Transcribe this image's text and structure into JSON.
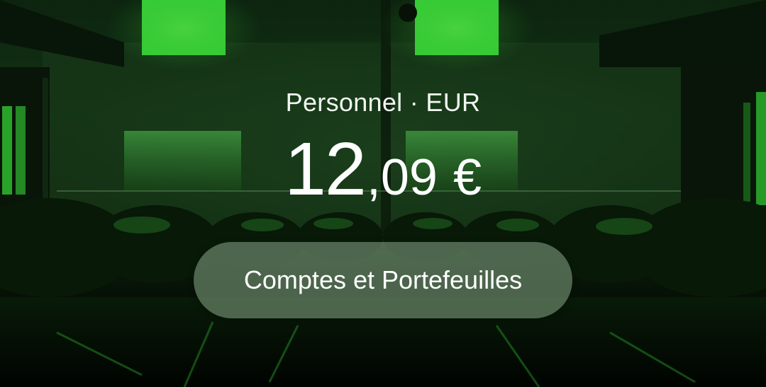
{
  "account": {
    "name": "Personnel",
    "separator": "·",
    "currency": "EUR"
  },
  "balance": {
    "integer_part": "12",
    "decimal_part": ",09",
    "currency_symbol": "€"
  },
  "actions": {
    "accounts_button_label": "Comptes et Portefeuilles"
  },
  "colors": {
    "accent_green": "#39e639",
    "button_background": "#789678"
  }
}
